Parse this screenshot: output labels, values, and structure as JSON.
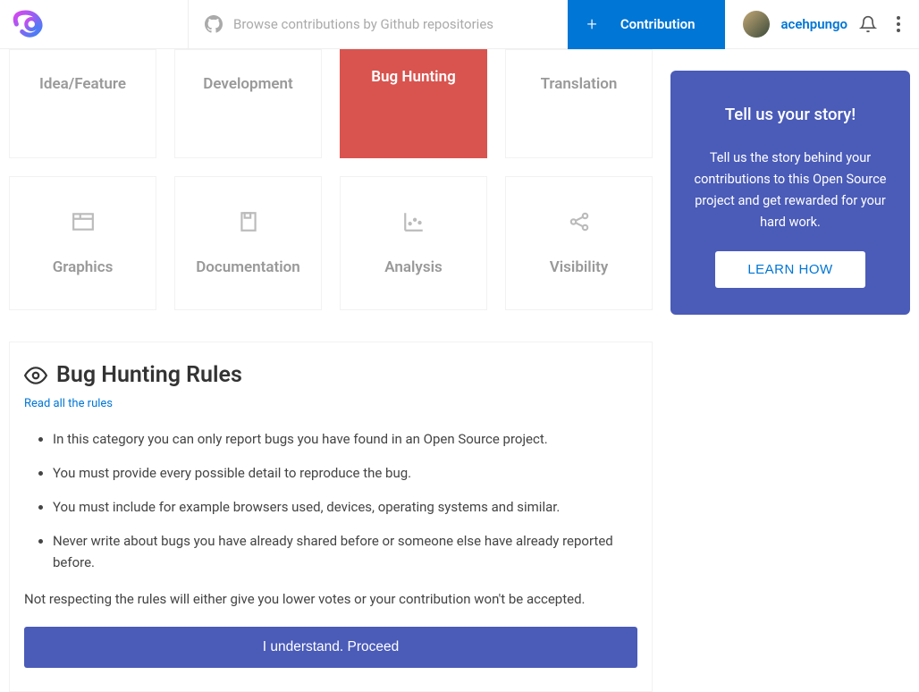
{
  "header": {
    "search_placeholder": "Browse contributions by Github repositories",
    "contribution_label": "Contribution",
    "username": "acehpungo"
  },
  "categories": {
    "row1": [
      "Idea/Feature",
      "Development",
      "Bug Hunting",
      "Translation"
    ],
    "row2": [
      "Graphics",
      "Documentation",
      "Analysis",
      "Visibility"
    ],
    "active_index": 2
  },
  "rules": {
    "title": "Bug Hunting Rules",
    "read_all": "Read all the rules",
    "items": [
      "In this category you can only report bugs you have found in an Open Source project.",
      "You must provide every possible detail to reproduce the bug.",
      "You must include for example browsers used, devices, operating systems and similar.",
      "Never write about bugs you have already shared before or someone else have already reported before."
    ],
    "warning": "Not respecting the rules will either give you lower votes or your contribution won't be accepted.",
    "proceed": "I understand. Proceed"
  },
  "sidebar": {
    "title": "Tell us your story!",
    "body": "Tell us the story behind your contributions to this Open Source project and get rewarded for your hard work.",
    "cta": "LEARN HOW"
  }
}
